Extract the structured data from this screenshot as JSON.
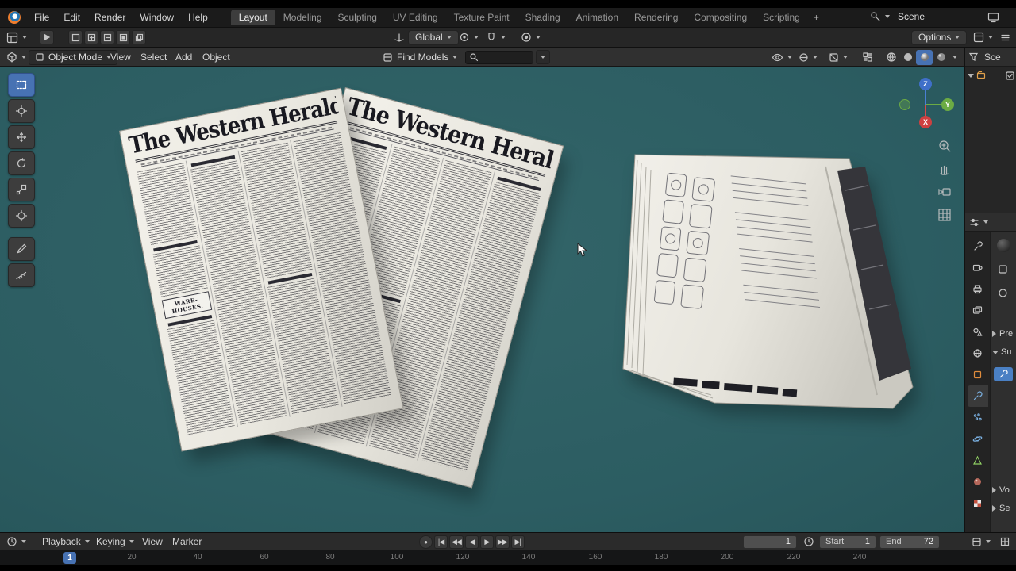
{
  "colors": {
    "accent": "#4772b3",
    "viewport_teal": "#2d5f64",
    "object_orange": "#e08c3c",
    "data_green": "#8fce63"
  },
  "topbar": {
    "menus": [
      {
        "label": "File"
      },
      {
        "label": "Edit"
      },
      {
        "label": "Render"
      },
      {
        "label": "Window"
      },
      {
        "label": "Help"
      }
    ],
    "tabs": [
      {
        "label": "Layout",
        "active": true
      },
      {
        "label": "Modeling",
        "active": false
      },
      {
        "label": "Sculpting",
        "active": false
      },
      {
        "label": "UV Editing",
        "active": false
      },
      {
        "label": "Texture Paint",
        "active": false
      },
      {
        "label": "Shading",
        "active": false
      },
      {
        "label": "Animation",
        "active": false
      },
      {
        "label": "Rendering",
        "active": false
      },
      {
        "label": "Compositing",
        "active": false
      },
      {
        "label": "Scripting",
        "active": false
      }
    ],
    "add_tab_label": "+",
    "scene_label": "Scene"
  },
  "tool_settings": {
    "orientation_label": "Global",
    "options_label": "Options"
  },
  "viewport_header": {
    "mode_label": "Object Mode",
    "menus": [
      {
        "label": "View"
      },
      {
        "label": "Select"
      },
      {
        "label": "Add"
      },
      {
        "label": "Object"
      }
    ],
    "find_models_label": "Find Models",
    "search_value": ""
  },
  "scene_objects": {
    "newspaper_title": "The Western Herald.",
    "warehouse_heading": "WARE-HOUSES."
  },
  "nav_gizmo": {
    "z_label": "Z",
    "y_label": "Y",
    "x_label": "X"
  },
  "outliner": {
    "header_label": "Sce"
  },
  "properties_panel": {
    "tab_icons": [
      "tool",
      "render",
      "output",
      "view-layer",
      "scene",
      "world",
      "object",
      "modifiers",
      "particles",
      "physics",
      "object-data",
      "material",
      "texture"
    ],
    "panels": [
      {
        "label": "Pre"
      },
      {
        "label": "Su"
      },
      {
        "label": "Vo"
      },
      {
        "label": "Se"
      }
    ]
  },
  "timeline": {
    "menus": [
      {
        "label": "Playback"
      },
      {
        "label": "Keying"
      },
      {
        "label": "View"
      },
      {
        "label": "Marker"
      }
    ],
    "transport": [
      {
        "name": "auto-key",
        "glyph": "●"
      },
      {
        "name": "jump-to-start",
        "glyph": "|◀"
      },
      {
        "name": "prev-keyframe",
        "glyph": "◀◀"
      },
      {
        "name": "play-reverse",
        "glyph": "◀"
      },
      {
        "name": "play",
        "glyph": "▶"
      },
      {
        "name": "next-keyframe",
        "glyph": "▶▶"
      },
      {
        "name": "jump-to-end",
        "glyph": "▶|"
      }
    ],
    "current_frame_value": "1",
    "start_label": "Start",
    "start_value": "1",
    "end_label": "End",
    "end_value": "72",
    "playhead_label": "1",
    "ruler_ticks": [
      "20",
      "40",
      "60",
      "80",
      "100",
      "120",
      "140",
      "160",
      "180",
      "200",
      "220",
      "240"
    ]
  }
}
